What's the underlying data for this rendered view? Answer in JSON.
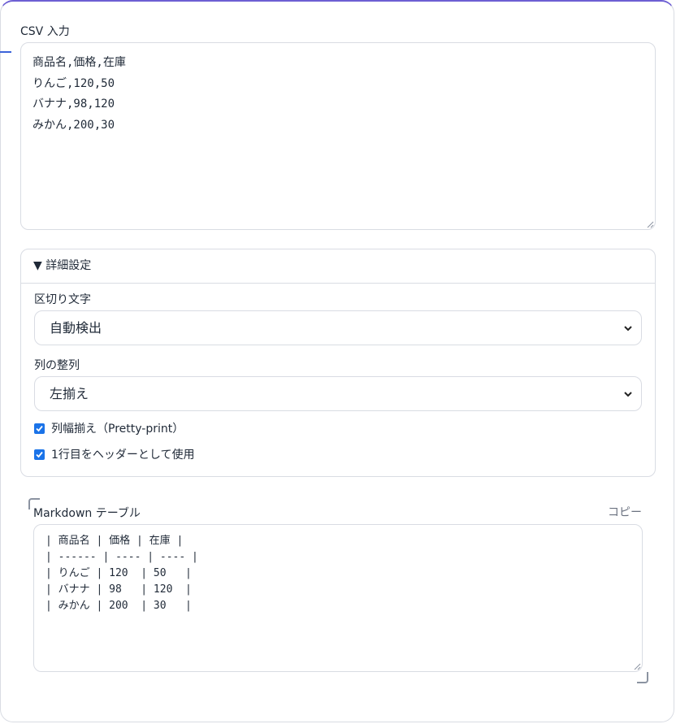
{
  "csv": {
    "label": "CSV 入力",
    "value": "商品名,価格,在庫\nりんご,120,50\nバナナ,98,120\nみかん,200,30"
  },
  "settings": {
    "summary": "▼ 詳細設定",
    "delimiter_label": "区切り文字",
    "delimiter_value": "自動検出",
    "align_label": "列の整列",
    "align_value": "左揃え",
    "pretty_label": "列幅揃え（Pretty-print）",
    "pretty_checked": true,
    "header_label": "1行目をヘッダーとして使用",
    "header_checked": true
  },
  "output": {
    "label": "Markdown テーブル",
    "copy_label": "コピー",
    "value": "| 商品名 | 価格 | 在庫 |\n| ------ | ---- | ---- |\n| りんご | 120  | 50   |\n| バナナ | 98   | 120  |\n| みかん | 200  | 30   |"
  },
  "colors": {
    "accent": "#6d5fd3",
    "checkbox": "#1a73e8",
    "border": "#d9dce3"
  }
}
